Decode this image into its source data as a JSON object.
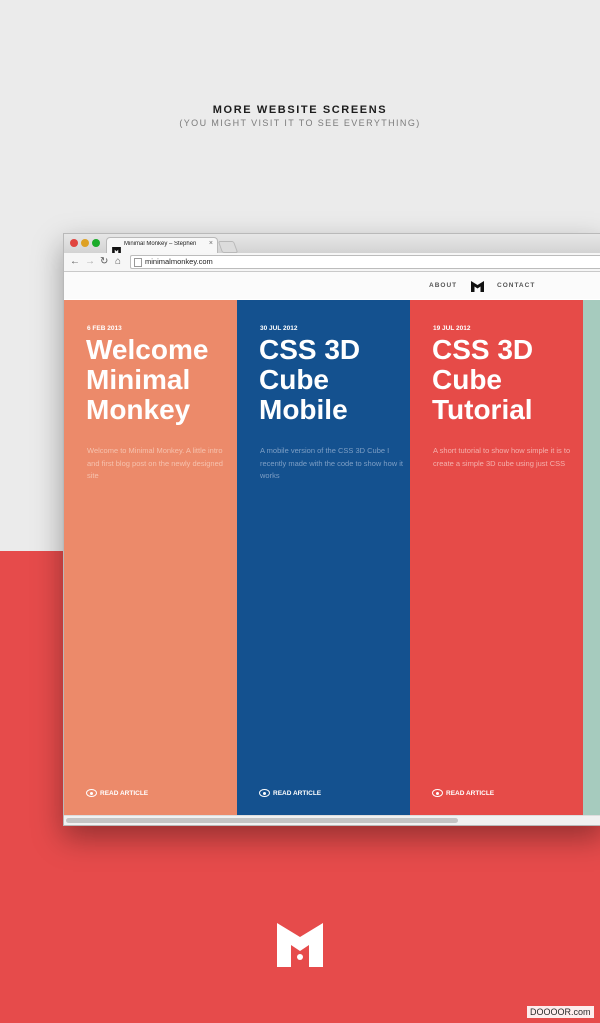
{
  "header": {
    "title": "MORE WEBSITE SCREENS",
    "subtitle": "(YOU MIGHT VISIT IT TO SEE EVERYTHING)"
  },
  "browser": {
    "tab_title": "Minimal Monkey – Stephen",
    "tab_close": "×",
    "back_icon": "←",
    "forward_icon": "→",
    "reload_icon": "↻",
    "home_icon": "⌂",
    "url": "minimalmonkey.com"
  },
  "site": {
    "nav": {
      "about": "ABOUT",
      "contact": "CONTACT"
    },
    "posts": [
      {
        "date": "6 FEB 2013",
        "title_lines": [
          "Welcome",
          "Minimal",
          "Monkey"
        ],
        "excerpt": "Welcome to Minimal Monkey. A little intro and first blog post on the newly designed site",
        "cta": "READ ARTICLE",
        "color": "#ec8a6a"
      },
      {
        "date": "30 JUL 2012",
        "title_lines": [
          "CSS 3D",
          "Cube",
          "Mobile"
        ],
        "excerpt": "A mobile version of the CSS 3D Cube I recently made with the code to show how it works",
        "cta": "READ ARTICLE",
        "color": "#14518f"
      },
      {
        "date": "19 JUL 2012",
        "title_lines": [
          "CSS 3D",
          "Cube",
          "Tutorial"
        ],
        "excerpt": "A short tutorial to show how simple it is to create a simple 3D cube using just CSS",
        "cta": "READ ARTICLE",
        "color": "#e64b48"
      }
    ],
    "partial_column_color": "#a6cbbe"
  },
  "footer": {
    "logo_icon": "minimal-monkey-logo",
    "accent": "#e64b4b"
  },
  "watermark": "DOOOOR.com"
}
